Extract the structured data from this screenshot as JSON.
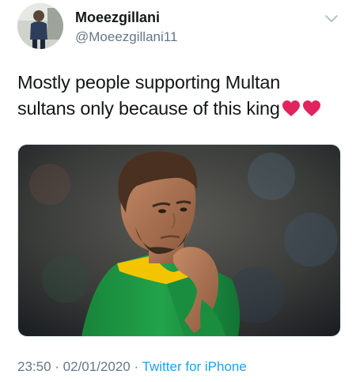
{
  "user": {
    "display_name": "Moeezgillani",
    "handle": "@Moeezgillani11"
  },
  "tweet": {
    "text_line1": "Mostly people supporting Multan",
    "text_line2": "sultans only because of this king",
    "emoji": [
      "red-heart",
      "red-heart"
    ]
  },
  "footer": {
    "time": "23:50",
    "sep1": " · ",
    "date": "02/01/2020",
    "sep2": " · ",
    "source": "Twitter for iPhone"
  },
  "colors": {
    "text": "#14171a",
    "muted": "#657786",
    "link": "#1da1f2",
    "heart": "#e0245e",
    "jersey_green": "#1f9a3e",
    "jersey_collar": "#f2c500"
  }
}
